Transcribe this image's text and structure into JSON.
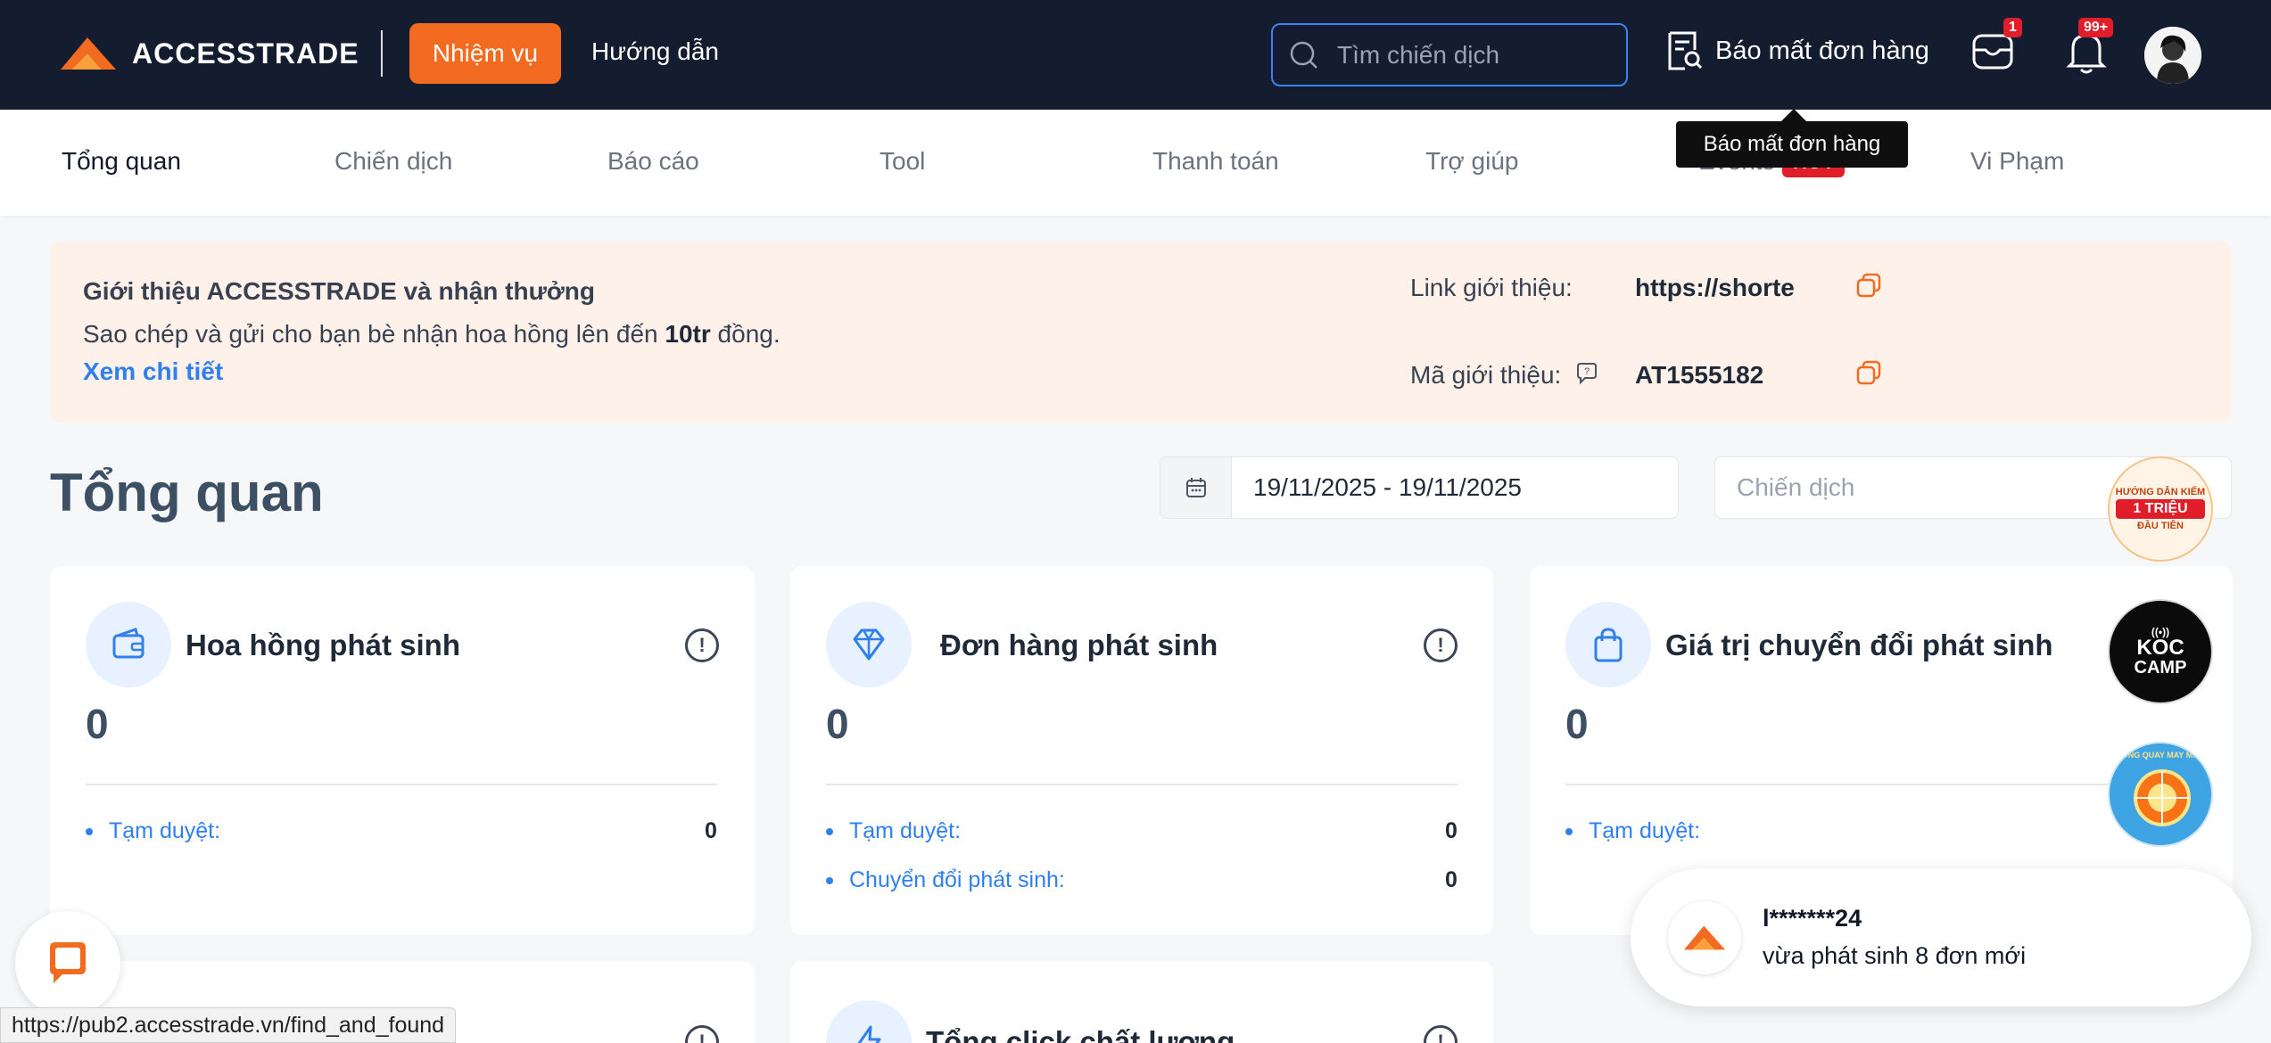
{
  "header": {
    "brand": "ACCESSTRADE",
    "nhiem_vu": "Nhiệm vụ",
    "huong_dan": "Hướng dẫn",
    "search_placeholder": "Tìm chiến dịch",
    "bao_mat": "Báo mất đơn hàng",
    "mail_badge": "1",
    "bell_badge": "99+",
    "accent": "#f26b21",
    "bg": "#141c2f"
  },
  "tooltip": "Báo mất đơn hàng",
  "nav": {
    "items": [
      "Tổng quan",
      "Chiến dịch",
      "Báo cáo",
      "Tool",
      "Thanh toán",
      "Trợ giúp",
      "Events",
      "Vi Phạm"
    ],
    "hot": "HOT"
  },
  "referral": {
    "title": "Giới thiệu ACCESSTRADE và nhận thưởng",
    "desc_pre": "Sao chép và gửi cho bạn bè nhận hoa hồng lên đến ",
    "desc_bold": "10tr",
    "desc_post": " đồng.",
    "detail_link": "Xem chi tiết",
    "link_label": "Link giới thiệu:",
    "link_value": "https://shorte",
    "code_label": "Mã giới thiệu:",
    "code_value": "AT1555182"
  },
  "overview": {
    "title": "Tổng quan",
    "date_range": "19/11/2025 - 19/11/2025",
    "campaign_placeholder": "Chiến dịch"
  },
  "cards": [
    {
      "title": "Hoa hồng phát sinh",
      "value": "0",
      "rows": [
        {
          "label": "Tạm duyệt:",
          "value": "0"
        }
      ],
      "icon": "wallet-icon"
    },
    {
      "title": "Đơn hàng phát sinh",
      "value": "0",
      "rows": [
        {
          "label": "Tạm duyệt:",
          "value": "0"
        },
        {
          "label": "Chuyển đổi phát sinh:",
          "value": "0"
        }
      ],
      "icon": "diamond-icon"
    },
    {
      "title": "Giá trị chuyển đổi phát sinh",
      "value": "0",
      "rows": [
        {
          "label": "Tạm duyệt:",
          "value": ""
        }
      ],
      "icon": "bag-icon"
    },
    {
      "title": "Tổng click chất lượng",
      "icon": "lightning-icon"
    }
  ],
  "float_badges": {
    "guide": [
      "HƯỚNG DẪN KIẾM",
      "1 TRIỆU",
      "ĐẦU TIÊN"
    ],
    "koc": [
      "KOC",
      "CAMP"
    ],
    "wheel": "VÒNG QUAY MAY MẮN"
  },
  "notification": {
    "user": "l*******24",
    "message": "vừa phát sinh 8 đơn mới"
  },
  "status_url": "https://pub2.accesstrade.vn/find_and_found"
}
